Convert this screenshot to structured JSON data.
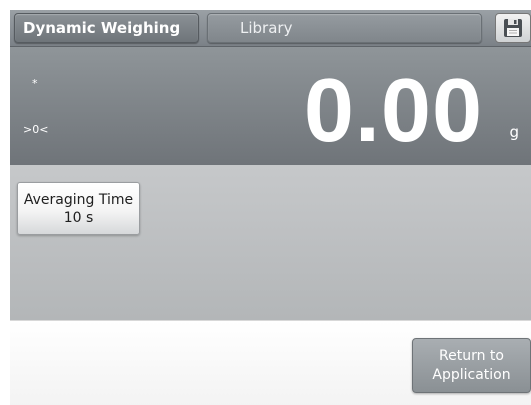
{
  "header": {
    "mode_tab": "Dynamic Weighing",
    "library_tab": "Library",
    "save_icon": "floppy-disk-icon"
  },
  "display": {
    "stable_indicator": "*",
    "center_zero_indicator": ">0<",
    "weight": "0.00",
    "unit": "g"
  },
  "parameters": {
    "averaging_time_label": "Averaging Time",
    "averaging_time_value": "10 s"
  },
  "footer": {
    "return_line1": "Return to",
    "return_line2": "Application"
  },
  "colors": {
    "header_gray": "#7b8187",
    "display_gray": "#7f8489",
    "panel_gray": "#bfc1c3",
    "text_white": "#ffffff"
  }
}
